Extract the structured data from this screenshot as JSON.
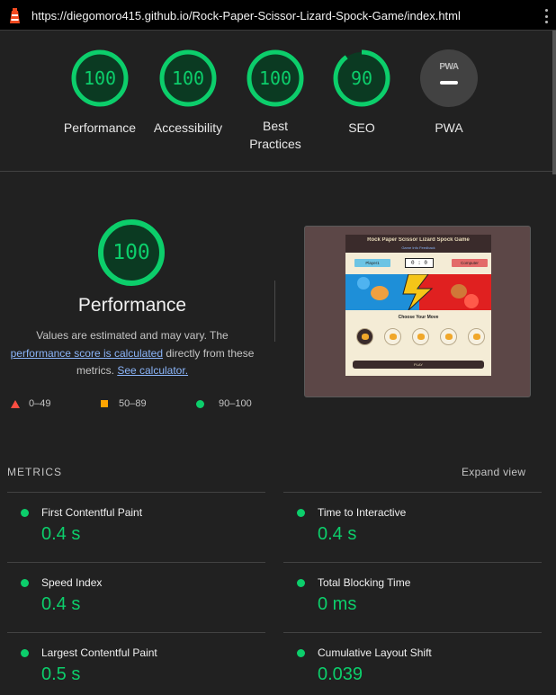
{
  "browser": {
    "url": "https://diegomoro415.github.io/Rock-Paper-Scissor-Lizard-Spock-Game/index.html",
    "icon": "lighthouse-icon",
    "menu_icon": "kebab-menu-icon"
  },
  "summary_gauges": [
    {
      "label": "Performance",
      "score": "100",
      "fraction": 1.0,
      "color": "#0cce6b"
    },
    {
      "label": "Accessibility",
      "score": "100",
      "fraction": 1.0,
      "color": "#0cce6b"
    },
    {
      "label": "Best Practices",
      "score": "100",
      "fraction": 1.0,
      "color": "#0cce6b"
    },
    {
      "label": "SEO",
      "score": "90",
      "fraction": 0.9,
      "color": "#0cce6b"
    },
    {
      "label": "PWA",
      "badge": "PWA"
    }
  ],
  "performance": {
    "score": "100",
    "title": "Performance",
    "desc_start": "Values are estimated and may vary. The ",
    "desc_link": "performance score is calculated",
    "desc_mid": " directly from these metrics. ",
    "calc_link": "See calculator."
  },
  "legend": [
    {
      "range": "0–49",
      "shape": "triangle",
      "color": "#ff4e42"
    },
    {
      "range": "50–89",
      "shape": "square",
      "color": "#ffa400"
    },
    {
      "range": "90–100",
      "shape": "circle",
      "color": "#0cce6b"
    }
  ],
  "screenshot": {
    "game_title": "Rock Paper Scissor Lizard Spock Game",
    "game_subtitle": "Game Info Feedback",
    "player_label": "Player1",
    "score": "0 : 0",
    "computer_label": "Computer",
    "choose_label": "Choose Your Move",
    "play_label": "PLAY"
  },
  "metrics": {
    "heading": "METRICS",
    "expand_label": "Expand view",
    "items": [
      {
        "name": "First Contentful Paint",
        "value": "0.4 s"
      },
      {
        "name": "Time to Interactive",
        "value": "0.4 s"
      },
      {
        "name": "Speed Index",
        "value": "0.4 s"
      },
      {
        "name": "Total Blocking Time",
        "value": "0 ms"
      },
      {
        "name": "Largest Contentful Paint",
        "value": "0.5 s"
      },
      {
        "name": "Cumulative Layout Shift",
        "value": "0.039"
      }
    ]
  },
  "colors": {
    "pass": "#0cce6b",
    "average": "#ffa400",
    "fail": "#ff4e42",
    "background": "#212121",
    "link": "#8ab4f8"
  }
}
